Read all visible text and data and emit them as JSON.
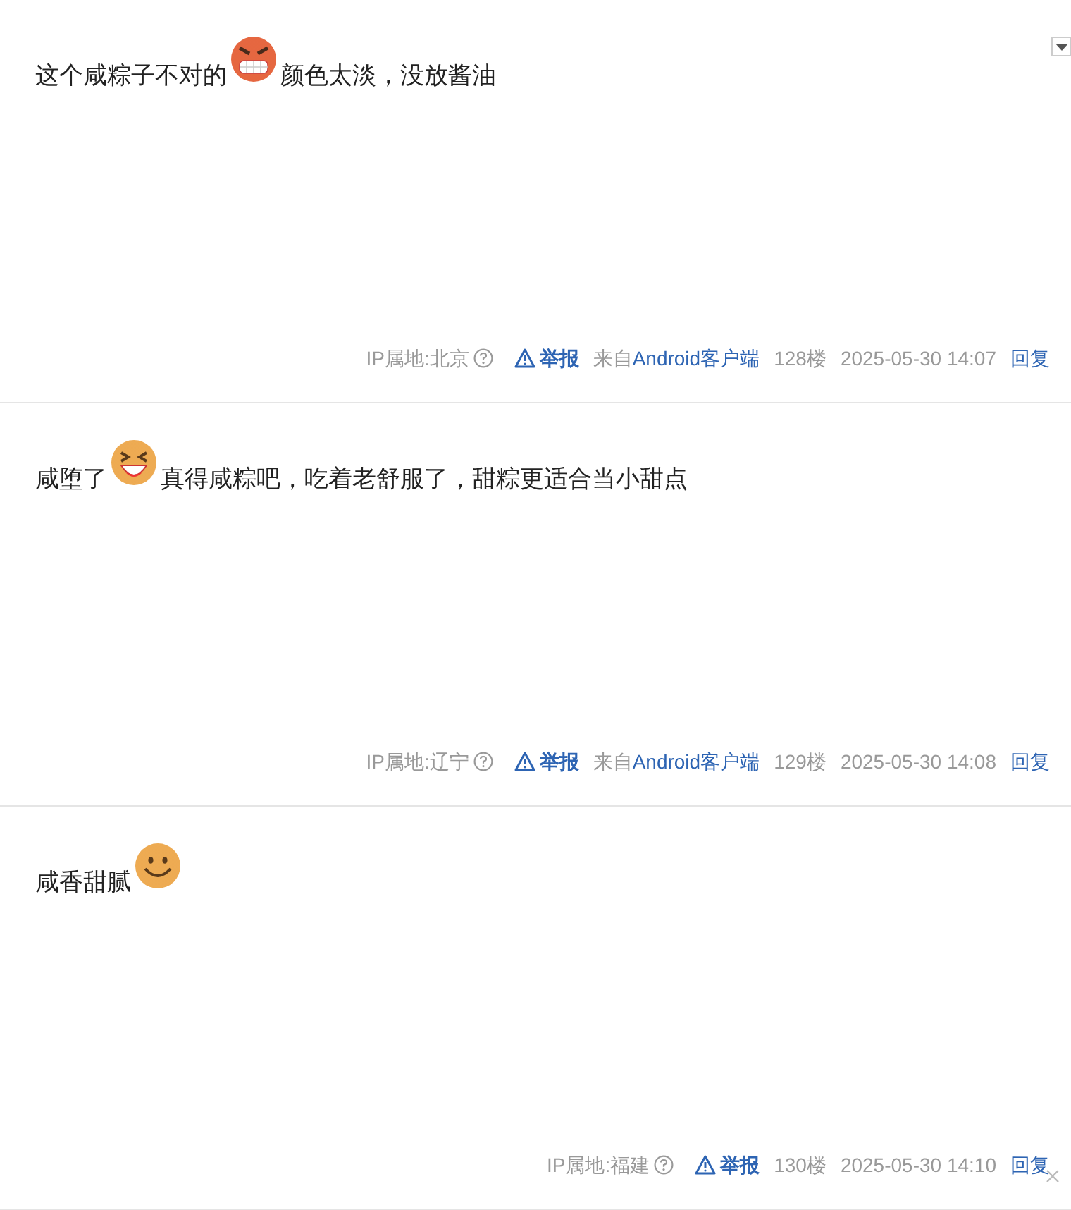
{
  "posts": [
    {
      "content": [
        {
          "kind": "text",
          "text": "这个咸粽子不对的"
        },
        {
          "kind": "angry"
        },
        {
          "kind": "text",
          "text": "颜色太淡，没放酱油"
        }
      ],
      "menu": true,
      "ip": "IP属地:北京",
      "report": "举报",
      "source_prefix": "来自",
      "source": "Android客户端",
      "floor": "128楼",
      "time": "2025-05-30 14:07",
      "reply": "回复",
      "close": false
    },
    {
      "content": [
        {
          "kind": "text",
          "text": "咸堕了"
        },
        {
          "kind": "laugh"
        },
        {
          "kind": "text",
          "text": "真得咸粽吧，吃着老舒服了，甜粽更适合当小甜点"
        }
      ],
      "menu": false,
      "ip": "IP属地:辽宁",
      "report": "举报",
      "source_prefix": "来自",
      "source": "Android客户端",
      "floor": "129楼",
      "time": "2025-05-30 14:08",
      "reply": "回复",
      "close": false
    },
    {
      "content": [
        {
          "kind": "text",
          "text": "咸香甜腻"
        },
        {
          "kind": "smile"
        }
      ],
      "menu": false,
      "ip": "IP属地:福建",
      "report": "举报",
      "floor": "130楼",
      "time": "2025-05-30 14:10",
      "reply": "回复",
      "close": true
    }
  ]
}
